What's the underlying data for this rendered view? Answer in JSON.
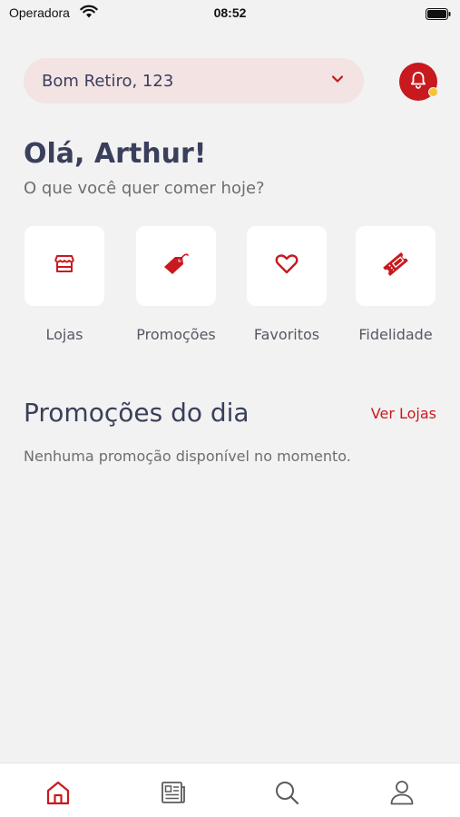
{
  "status_bar": {
    "carrier": "Operadora",
    "time": "08:52"
  },
  "header": {
    "address": "Bom Retiro, 123",
    "icons": [
      "chevron-down-icon",
      "bell-icon"
    ]
  },
  "greeting": {
    "title": "Olá, Arthur!",
    "subtitle": "O que você quer comer hoje?"
  },
  "categories": [
    {
      "label": "Lojas",
      "icon": "store-icon"
    },
    {
      "label": "Promoções",
      "icon": "tag-icon"
    },
    {
      "label": "Favoritos",
      "icon": "heart-icon"
    },
    {
      "label": "Fidelidade",
      "icon": "ticket-icon"
    }
  ],
  "promotions": {
    "title": "Promoções do dia",
    "link_label": "Ver Lojas",
    "empty_message": "Nenhuma promoção disponível no momento."
  },
  "tab_bar": {
    "tabs": [
      "home-icon",
      "news-icon",
      "search-icon",
      "profile-icon"
    ],
    "active": "home-icon"
  },
  "colors": {
    "accent": "#c8191e",
    "text_primary": "#3a3f5c",
    "pill_bg": "#f3e3e3",
    "notification_dot": "#f6c431",
    "background": "#f2f2f2"
  }
}
